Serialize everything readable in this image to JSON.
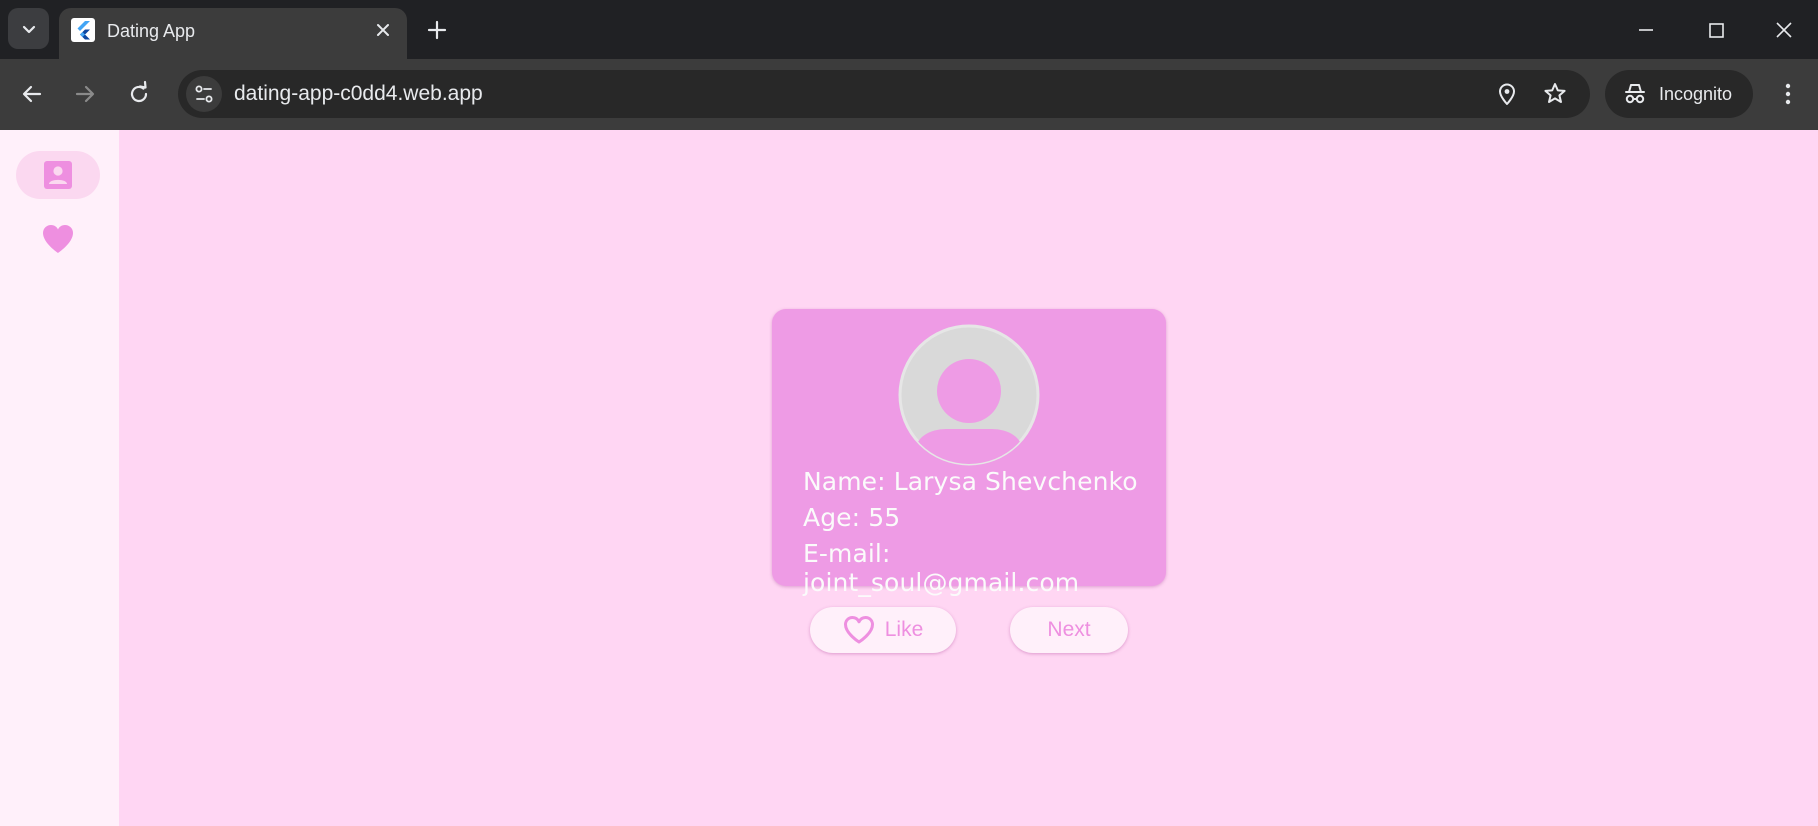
{
  "browser": {
    "tab_title": "Dating App",
    "url": "dating-app-c0dd4.web.app",
    "profile_label": "Incognito",
    "icons": {
      "tab_search": "chevron-down-icon",
      "favicon": "flutter-icon",
      "tab_close": "close-icon",
      "new_tab": "plus-icon",
      "back": "arrow-left-icon",
      "forward": "arrow-right-icon",
      "reload": "reload-icon",
      "site_info": "tune-icon",
      "location": "location-pin-icon",
      "bookmark": "star-icon",
      "incognito": "incognito-icon",
      "menu": "kebab-menu-icon"
    }
  },
  "nav_rail": {
    "items": [
      {
        "icon": "contact-card-icon",
        "active": true
      },
      {
        "icon": "heart-icon",
        "active": false
      }
    ]
  },
  "profile": {
    "name_line": "Name: Larysa Shevchenko",
    "age_line": "Age: 55",
    "email_line": "E-mail: joint_soul@gmail.com"
  },
  "actions": {
    "like_label": "Like",
    "next_label": "Next"
  },
  "colors": {
    "background": "#ffd6f3",
    "rail": "#fff0fa",
    "card": "#ee9be5",
    "accent": "#ee8fe0",
    "chrome_dark": "#202124"
  }
}
